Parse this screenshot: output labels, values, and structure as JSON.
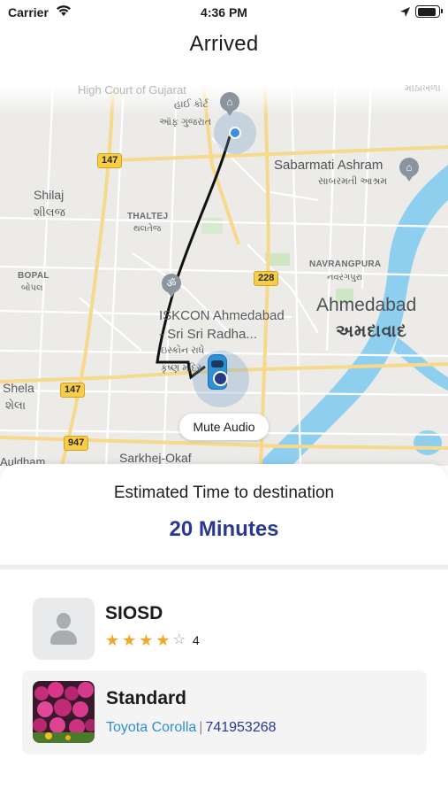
{
  "status_bar": {
    "carrier": "Carrier",
    "time": "4:36 PM",
    "wifi_icon": "wifi-icon",
    "location_icon": "location-arrow-icon",
    "battery_icon": "battery-icon"
  },
  "header": {
    "title": "Arrived"
  },
  "map": {
    "labels": {
      "top_faint": "High Court of Gujarat",
      "top_gu1": "હાઈ કોર્ટ",
      "top_gu2": "ઑફ ગુજરાત",
      "top_right_faint": "મીઠાખળી",
      "sabarmati": "Sabarmati Ashram",
      "sabarmati_gu": "સાબરમતી આશ્રમ",
      "shilaj": "Shilaj",
      "shilaj_gu": "શીલજ",
      "thaltej": "THALTEJ",
      "thaltej_gu": "થલતેજ",
      "bopal": "BOPAL",
      "bopal_gu": "બોપલ",
      "navrangpura": "NAVRANGPURA",
      "navrangpura_gu": "નવરંગપુરા",
      "iskcon1": "ISKCON Ahmedabad",
      "iskcon2": "- Sri Sri Radha...",
      "iskcon_gu1": "ઇસ્કોન રાધે",
      "iskcon_gu2": "કૃષ્ણ મંદિર",
      "ahmedabad": "Ahmedabad",
      "ahmedabad_gu": "અમદાવાદ",
      "shela": "Shela",
      "shela_gu": "શેલા",
      "bottom_left": "Auldham",
      "bottom_mid": "Sarkhej-Okaf"
    },
    "highway_shields": [
      "147",
      "228",
      "147",
      "947"
    ],
    "colors": {
      "land": "#ecebe8",
      "road_major": "#f7d98b",
      "water": "#8ecff0",
      "route": "#111111",
      "origin_dot": "#3b8ee8",
      "destination_dot": "#283a8a"
    },
    "mute_audio_label": "Mute Audio"
  },
  "trip": {
    "eta_label": "Estimated Time to destination",
    "eta_value": "20 Minutes"
  },
  "driver": {
    "name": "SIOSD",
    "rating": 4,
    "rating_max": 5,
    "rating_text": "4",
    "avatar_icon": "user-placeholder-icon"
  },
  "vehicle": {
    "type": "Standard",
    "model": "Toyota Corolla",
    "separator": "|",
    "plate": "741953268",
    "photo_icon": "flowers-photo"
  }
}
